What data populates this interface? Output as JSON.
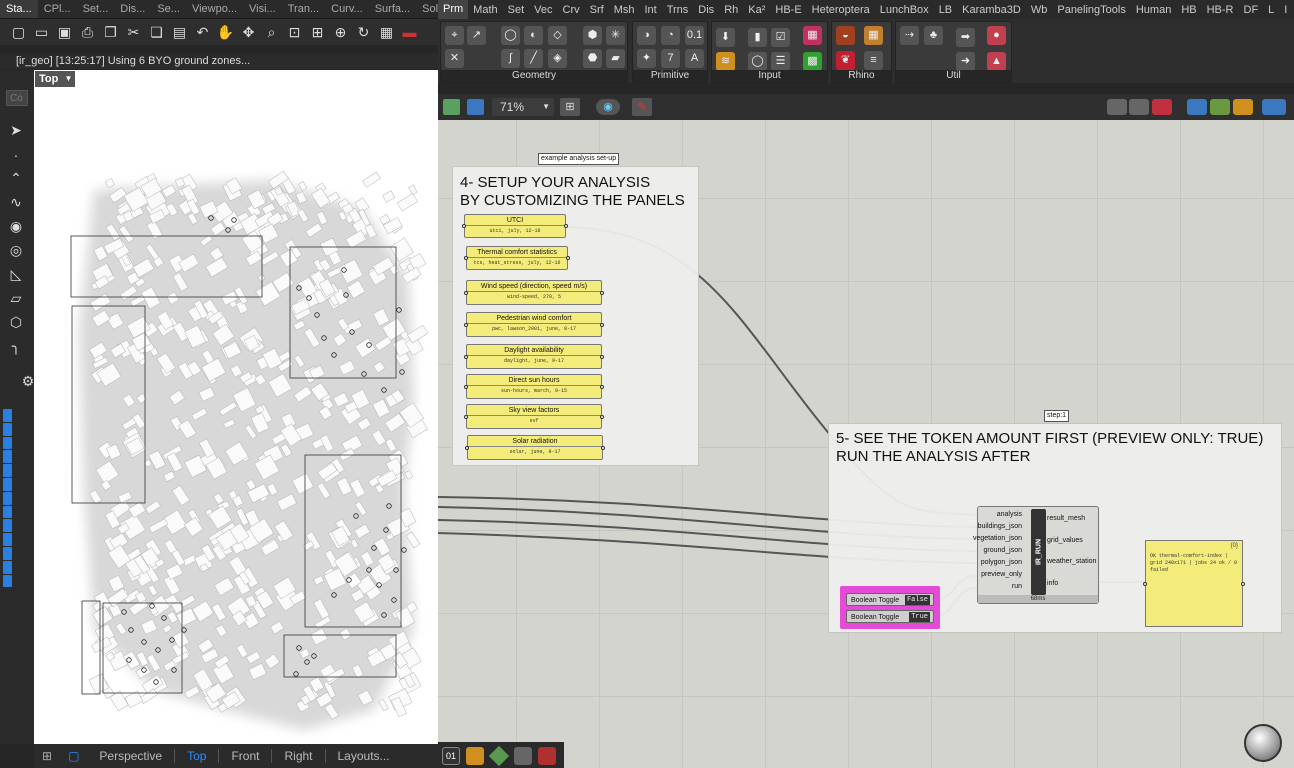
{
  "rhino": {
    "tabs": [
      "Sta...",
      "CPl...",
      "Set...",
      "Dis...",
      "Se...",
      "Viewpo...",
      "Visi...",
      "Tran...",
      "Curv...",
      "Surfa...",
      "Solid..."
    ],
    "command_history": "[ir_geo] [13:25:17] Using 6 BYO ground zones...",
    "command_prompt": "Co",
    "viewport_label": "Top",
    "viewport_tabs": [
      "Perspective",
      "Top",
      "Front",
      "Right",
      "Layouts..."
    ],
    "active_viewport_tab": "Top"
  },
  "gh": {
    "menu": [
      "Prm",
      "Math",
      "Set",
      "Vec",
      "Crv",
      "Srf",
      "Msh",
      "Int",
      "Trns",
      "Dis",
      "Rh",
      "Ka²",
      "HB-E",
      "Heteroptera",
      "LunchBox",
      "LB",
      "Karamba3D",
      "PanelingTools",
      "Human",
      "HB",
      "HB-R",
      "DF",
      "L",
      "I"
    ],
    "menu_extra": "Wb",
    "ribbon_groups": [
      "Geometry",
      "Primitive",
      "Input",
      "Rhino",
      "Util"
    ],
    "zoom": "71%",
    "group1": {
      "tag": "example analysis set-up",
      "title_line1": "4- SETUP YOUR ANALYSIS",
      "title_line2": "BY CUSTOMIZING THE PANELS",
      "panels": [
        {
          "header": "UTCI",
          "value": "utci, july, 12-16"
        },
        {
          "header": "Thermal comfort statistics",
          "value": "tcs, heat_stress, july, 12-16"
        },
        {
          "header": "Wind speed (direction, speed m/s)",
          "value": "wind-speed, 270, 5"
        },
        {
          "header": "Pedestrian wind comfort",
          "value": "pwc, lawson_2001, june, 8-17"
        },
        {
          "header": "Daylight availability",
          "value": "daylight, june, 9-17"
        },
        {
          "header": "Direct sun hours",
          "value": "sun-hours, march, 9-15"
        },
        {
          "header": "Sky view factors",
          "value": "svf"
        },
        {
          "header": "Solar radiation",
          "value": "solar, june, 9-17"
        }
      ]
    },
    "group2": {
      "tag": "step:1",
      "title_line1": "5- SEE THE TOKEN AMOUNT FIRST (PREVIEW ONLY: TRUE)",
      "title_line2": "RUN THE ANALYSIS AFTER"
    },
    "node": {
      "name": "IR_RUN",
      "inputs": [
        "analysis",
        "buildings_json",
        "vegetation_json",
        "ground_json",
        "polygon_json",
        "preview_only",
        "run"
      ],
      "outputs": [
        "result_mesh",
        "grid_values",
        "weather_station",
        "info"
      ],
      "time": "68ms"
    },
    "toggles": [
      {
        "name": "Boolean Toggle",
        "value": "False"
      },
      {
        "name": "Boolean Toggle",
        "value": "True"
      }
    ],
    "output_panel": {
      "index": "{0}",
      "text": "OK  thermal-comfort-index | grid 240x171 | jobs 24 ok / 0 failed"
    }
  },
  "colors": {
    "panel": "#f4ec7a",
    "canvas": "#d4d4cf",
    "accent": "#2d8cff",
    "toggle_group": "#e64bd7"
  }
}
